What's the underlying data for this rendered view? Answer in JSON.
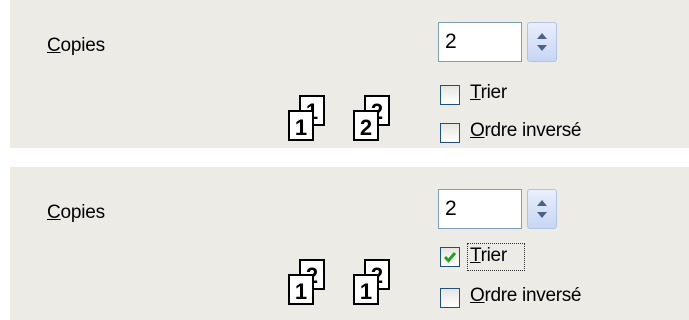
{
  "panels": [
    {
      "copies_label": "Copies",
      "copies_mnemonic": "C",
      "copies_rest": "opies",
      "copies_value": "2",
      "sort": {
        "mnemonic": "T",
        "rest": "rier",
        "checked": false
      },
      "reverse": {
        "mnemonic": "O",
        "rest": "rdre inversé",
        "checked": false
      },
      "pages_icon": [
        {
          "back": "1",
          "front": "1"
        },
        {
          "back": "2",
          "front": "2"
        }
      ]
    },
    {
      "copies_label": "Copies",
      "copies_mnemonic": "C",
      "copies_rest": "opies",
      "copies_value": "2",
      "sort": {
        "mnemonic": "T",
        "rest": "rier",
        "checked": true
      },
      "reverse": {
        "mnemonic": "O",
        "rest": "rdre inversé",
        "checked": false
      },
      "pages_icon": [
        {
          "back": "2",
          "front": "1"
        },
        {
          "back": "2",
          "front": "1"
        }
      ]
    }
  ],
  "icons": {
    "spin": "up-down-arrows-icon",
    "check": "checkmark-icon",
    "pages": "stacked-pages-icon"
  },
  "colors": {
    "panel_bg": "#ecebe6",
    "checkmark": "#21a121",
    "input_border": "#7f9db9",
    "checkbox_border": "#1c5180"
  }
}
